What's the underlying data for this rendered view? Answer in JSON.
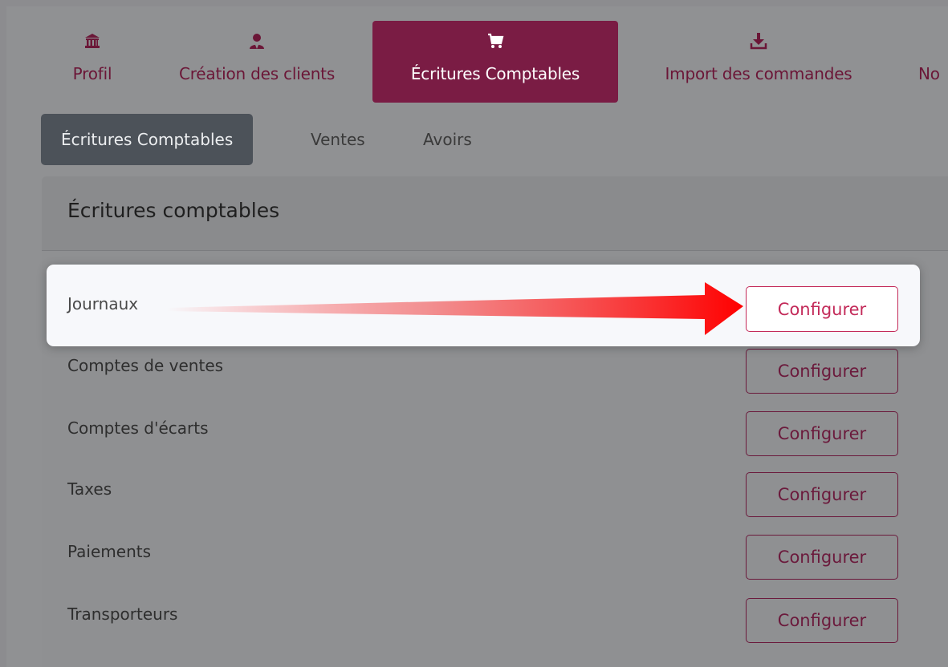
{
  "nav": {
    "items": [
      {
        "label": "Profil",
        "icon": "bank-icon"
      },
      {
        "label": "Création des clients",
        "icon": "user-icon"
      },
      {
        "label": "Écritures Comptables",
        "icon": "cart-icon"
      },
      {
        "label": "Import des commandes",
        "icon": "download-icon"
      },
      {
        "label": "No"
      }
    ]
  },
  "subtabs": [
    "Écritures Comptables",
    "Ventes",
    "Avoirs"
  ],
  "card": {
    "title": "Écritures comptables",
    "rows": [
      {
        "label": "Journaux",
        "button": "Configurer"
      },
      {
        "label": "Comptes de ventes",
        "button": "Configurer"
      },
      {
        "label": "Comptes d'écarts",
        "button": "Configurer"
      },
      {
        "label": "Taxes",
        "button": "Configurer"
      },
      {
        "label": "Paiements",
        "button": "Configurer"
      },
      {
        "label": "Transporteurs",
        "button": "Configurer"
      }
    ]
  },
  "colors": {
    "accent": "#7a1c44",
    "highlight_button": "#c32a59",
    "arrow": "#ff0000",
    "active_subtab": "#4c5259"
  }
}
